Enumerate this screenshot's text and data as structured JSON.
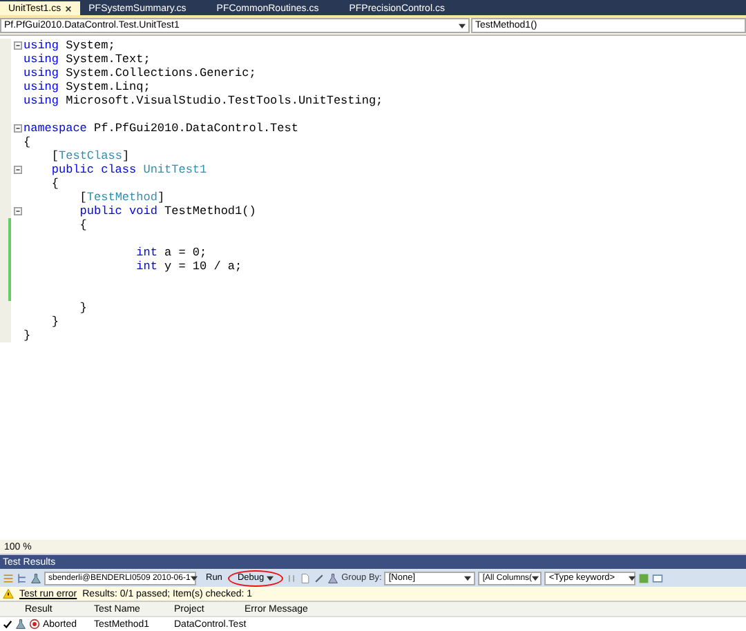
{
  "tabs": [
    {
      "label": "UnitTest1.cs",
      "selected": true,
      "closable": true
    },
    {
      "label": "PFSystemSummary.cs",
      "selected": false,
      "closable": false
    },
    {
      "label": "PFCommonRoutines.cs",
      "selected": false,
      "closable": false
    },
    {
      "label": "PFPrecisionControl.cs",
      "selected": false,
      "closable": false
    }
  ],
  "nav": {
    "type_dropdown": "Pf.PfGui2010.DataControl.Test.UnitTest1",
    "member_dropdown": "TestMethod1()"
  },
  "code_lines": [
    {
      "fold": true,
      "changed": false,
      "tokens": [
        {
          "kind": "keyword",
          "text": "using"
        },
        {
          "kind": "plain",
          "text": " System;"
        }
      ]
    },
    {
      "fold": false,
      "changed": false,
      "tokens": [
        {
          "kind": "keyword",
          "text": "using"
        },
        {
          "kind": "plain",
          "text": " System.Text;"
        }
      ]
    },
    {
      "fold": false,
      "changed": false,
      "tokens": [
        {
          "kind": "keyword",
          "text": "using"
        },
        {
          "kind": "plain",
          "text": " System.Collections.Generic;"
        }
      ]
    },
    {
      "fold": false,
      "changed": false,
      "tokens": [
        {
          "kind": "keyword",
          "text": "using"
        },
        {
          "kind": "plain",
          "text": " System.Linq;"
        }
      ]
    },
    {
      "fold": false,
      "changed": false,
      "tokens": [
        {
          "kind": "keyword",
          "text": "using"
        },
        {
          "kind": "plain",
          "text": " Microsoft.VisualStudio.TestTools.UnitTesting;"
        }
      ]
    },
    {
      "fold": false,
      "changed": false
    },
    {
      "fold": true,
      "changed": false,
      "tokens": [
        {
          "kind": "keyword",
          "text": "namespace"
        },
        {
          "kind": "plain",
          "text": " Pf.PfGui2010.DataControl.Test"
        }
      ]
    },
    {
      "fold": false,
      "changed": false,
      "tokens": [
        {
          "kind": "plain",
          "text": "{"
        }
      ]
    },
    {
      "fold": false,
      "changed": false,
      "tokens": [
        {
          "kind": "plain",
          "text": "    ["
        },
        {
          "kind": "type",
          "text": "TestClass"
        },
        {
          "kind": "plain",
          "text": "]"
        }
      ]
    },
    {
      "fold": true,
      "changed": false,
      "tokens": [
        {
          "kind": "keyword",
          "text": "    public class"
        },
        {
          "kind": "type",
          "text": " UnitTest1"
        }
      ]
    },
    {
      "fold": false,
      "changed": false,
      "tokens": [
        {
          "kind": "plain",
          "text": "    {"
        }
      ]
    },
    {
      "fold": false,
      "changed": false,
      "tokens": [
        {
          "kind": "plain",
          "text": "        ["
        },
        {
          "kind": "type",
          "text": "TestMethod"
        },
        {
          "kind": "plain",
          "text": "]"
        }
      ]
    },
    {
      "fold": true,
      "changed": false,
      "tokens": [
        {
          "kind": "keyword",
          "text": "        public void"
        },
        {
          "kind": "plain",
          "text": " TestMethod1()"
        }
      ]
    },
    {
      "fold": false,
      "changed": true,
      "tokens": [
        {
          "kind": "plain",
          "text": "        {"
        }
      ]
    },
    {
      "fold": false,
      "changed": true
    },
    {
      "fold": false,
      "changed": true,
      "tokens": [
        {
          "kind": "keyword",
          "text": "                int"
        },
        {
          "kind": "plain",
          "text": " a = 0;"
        }
      ]
    },
    {
      "fold": false,
      "changed": true,
      "tokens": [
        {
          "kind": "keyword",
          "text": "                int"
        },
        {
          "kind": "plain",
          "text": " y = 10 / a;"
        }
      ]
    },
    {
      "fold": false,
      "changed": true
    },
    {
      "fold": false,
      "changed": true
    },
    {
      "fold": false,
      "changed": false,
      "tokens": [
        {
          "kind": "plain",
          "text": "        }"
        }
      ]
    },
    {
      "fold": false,
      "changed": false,
      "tokens": [
        {
          "kind": "plain",
          "text": "    }"
        }
      ]
    },
    {
      "fold": false,
      "changed": false,
      "tokens": [
        {
          "kind": "plain",
          "text": "}"
        }
      ]
    }
  ],
  "zoom_level": "100 %",
  "test_results": {
    "title": "Test Results",
    "run_selector": "sbenderli@BENDERLI0509 2010-06-1",
    "run_button": "Run",
    "debug_button": "Debug",
    "group_by_label": "Group By:",
    "group_by": "[None]",
    "columns_filter": "[All Columns(",
    "keyword": {
      "placeholder": "<Type keyword>"
    },
    "error_link": "Test run error",
    "summary": "Results: 0/1 passed;  Item(s) checked: 1",
    "columns": [
      "Result",
      "Test Name",
      "Project",
      "Error Message"
    ],
    "rows": [
      {
        "checked": true,
        "result": "Aborted",
        "test_name": "TestMethod1",
        "project": "DataControl.Test"
      }
    ]
  }
}
